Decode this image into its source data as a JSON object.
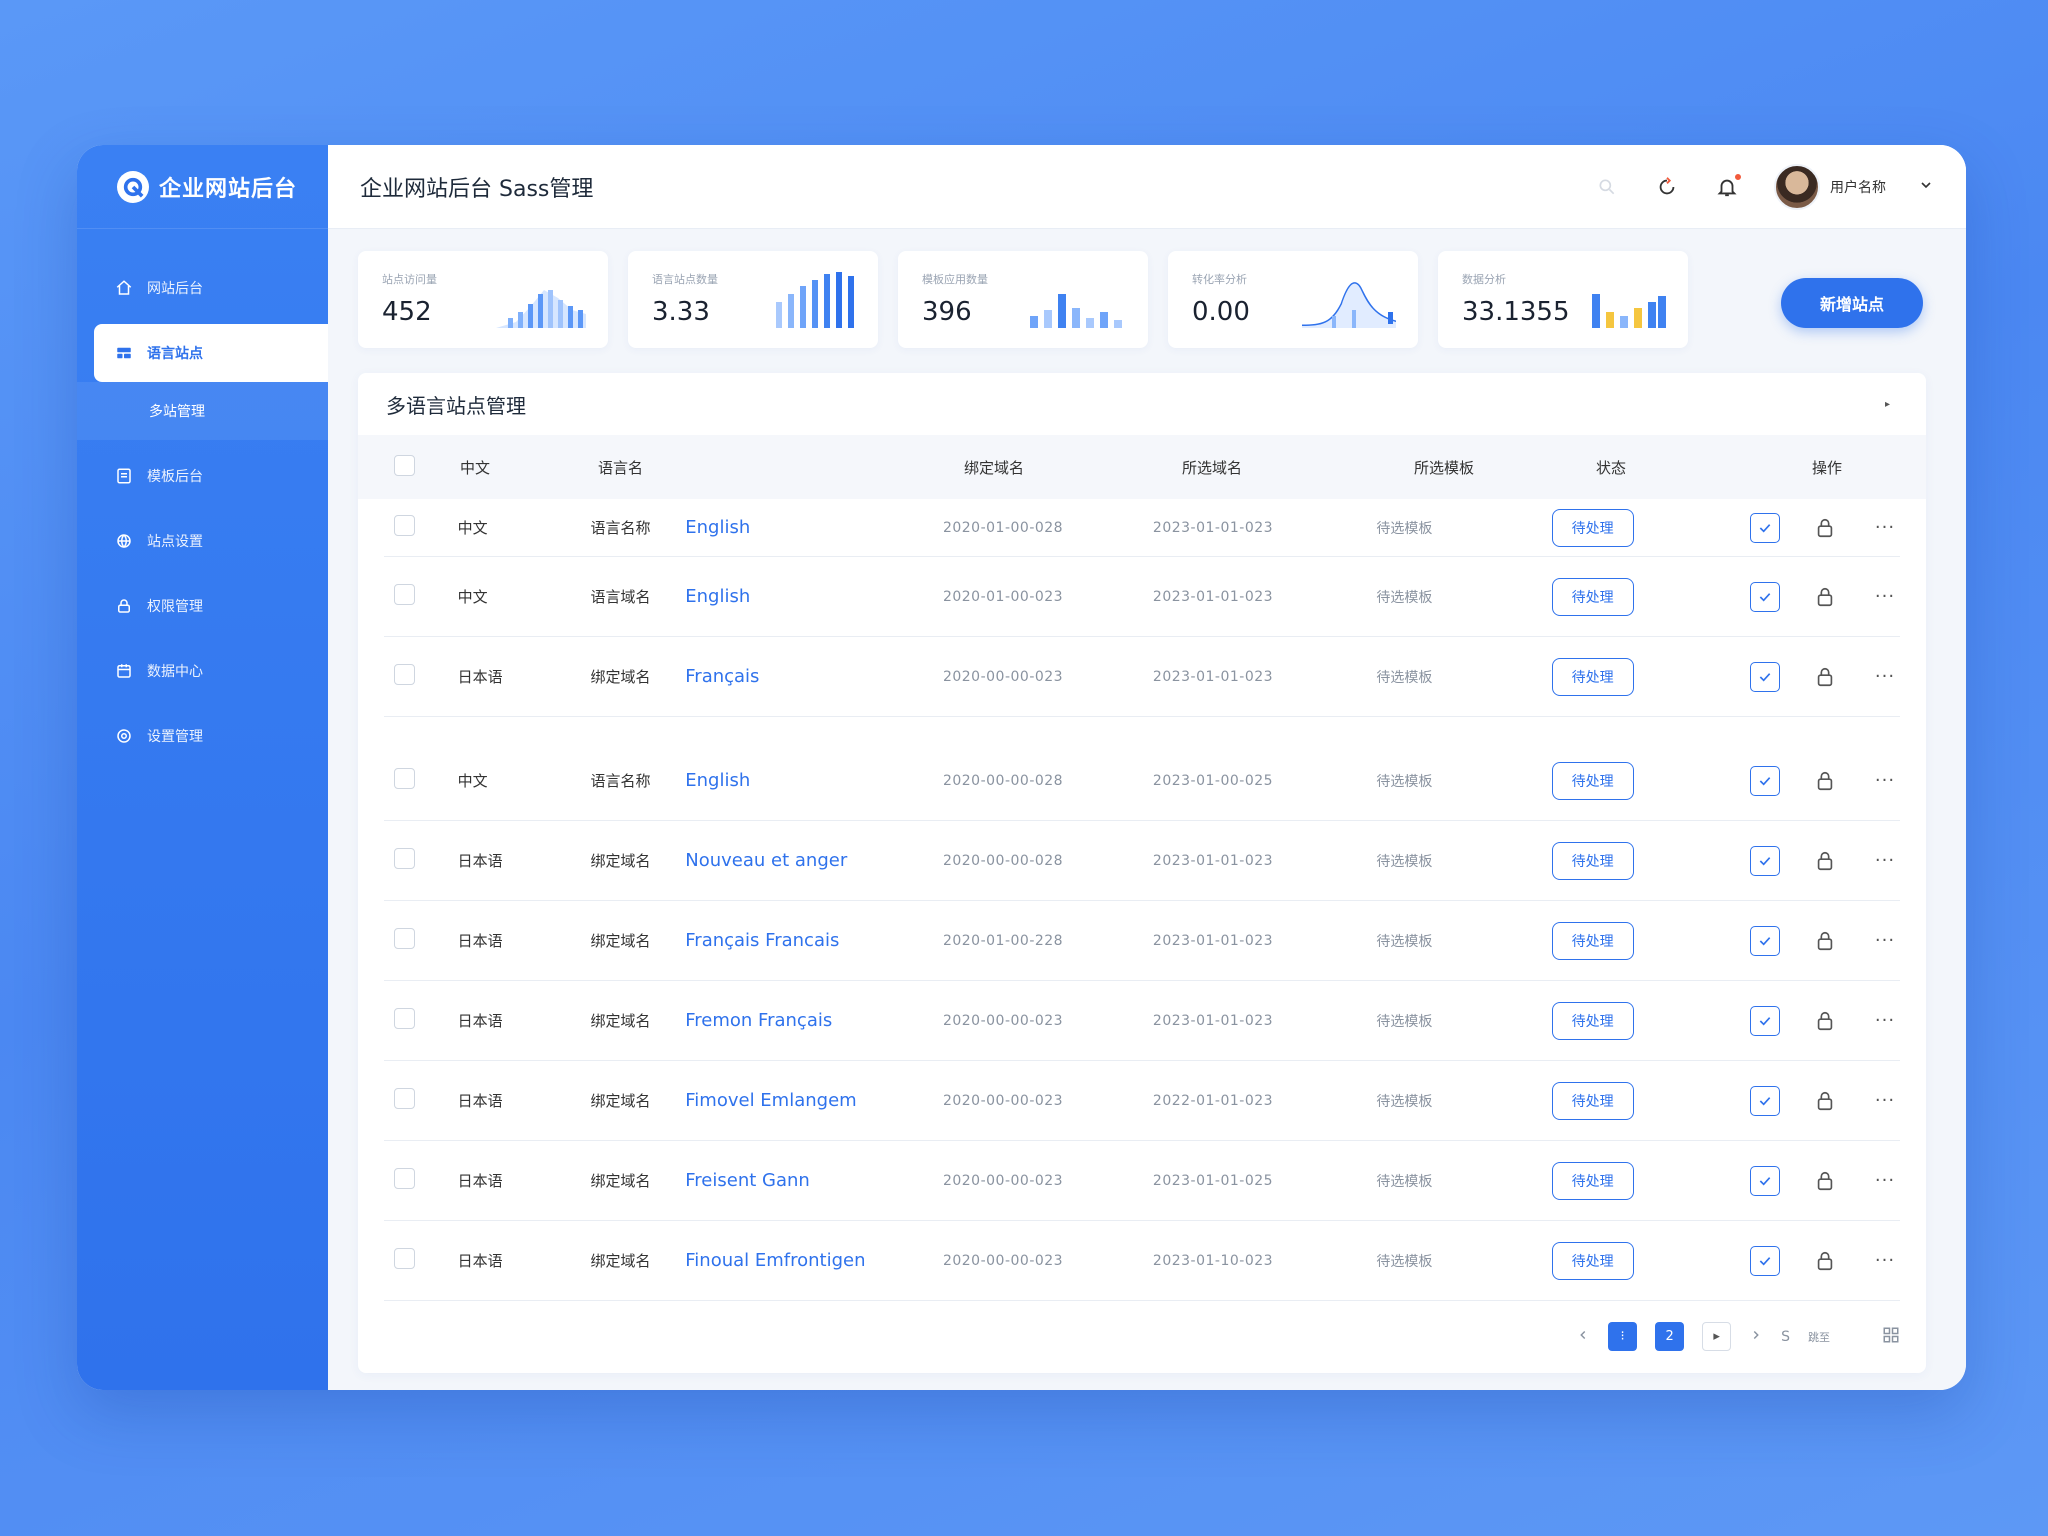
{
  "brand": {
    "title": "企业网站后台"
  },
  "sidebar": {
    "items": [
      {
        "label": "网站后台",
        "icon": "home-icon"
      },
      {
        "label": "语言站点",
        "icon": "layers-icon",
        "active": true
      },
      {
        "label": "多站管理",
        "icon": "",
        "sub": true
      },
      {
        "label": "模板后台",
        "icon": "document-icon"
      },
      {
        "label": "站点设置",
        "icon": "globe-icon"
      },
      {
        "label": "权限管理",
        "icon": "lock-icon"
      },
      {
        "label": "数据中心",
        "icon": "calendar-icon"
      },
      {
        "label": "设置管理",
        "icon": "settings-icon"
      }
    ]
  },
  "header": {
    "title": "企业网站后台 Sass管理",
    "user_name": "用户名称"
  },
  "stats": [
    {
      "label": "站点访问量",
      "value": "452",
      "chart": "area-bars"
    },
    {
      "label": "语言站点数量",
      "value": "3.33",
      "chart": "bars"
    },
    {
      "label": "模板应用数量",
      "value": "396",
      "chart": "small-bars"
    },
    {
      "label": "转化率分析",
      "value": "0.00",
      "chart": "bell"
    },
    {
      "label": "数据分析",
      "value": "33.1355",
      "chart": "color-bars"
    }
  ],
  "actions": {
    "new_site": "新增站点"
  },
  "panel": {
    "title": "多语言站点管理",
    "columns": [
      "中文",
      "语言名",
      "绑定域名",
      "所选域名",
      "所选模板",
      "状态",
      "操作"
    ],
    "rows": [
      {
        "cn": "中文",
        "key": "语言名称",
        "val": "English",
        "d1": "2020-01-00-028",
        "d2": "2023-01-01-023",
        "tpl": "待选模板",
        "status": "待处理"
      },
      {
        "cn": "中文",
        "key": "语言域名",
        "val": "English",
        "d1": "2020-01-00-023",
        "d2": "2023-01-01-023",
        "tpl": "待选模板",
        "status": "待处理"
      },
      {
        "cn": "日本语",
        "key": "绑定域名",
        "val": "Français",
        "d1": "2020-00-00-023",
        "d2": "2023-01-01-023",
        "tpl": "待选模板",
        "status": "待处理"
      },
      {
        "cn": "中文",
        "key": "语言名称",
        "val": "English",
        "d1": "2020-00-00-028",
        "d2": "2023-01-00-025",
        "tpl": "待选模板",
        "status": "待处理"
      },
      {
        "cn": "日本语",
        "key": "绑定域名",
        "val": "Nouveau et anger",
        "d1": "2020-00-00-028",
        "d2": "2023-01-01-023",
        "tpl": "待选模板",
        "status": "待处理"
      },
      {
        "cn": "日本语",
        "key": "绑定域名",
        "val": "Français Francais",
        "d1": "2020-01-00-228",
        "d2": "2023-01-01-023",
        "tpl": "待选模板",
        "status": "待处理"
      },
      {
        "cn": "日本语",
        "key": "绑定域名",
        "val": "Fremon Français",
        "d1": "2020-00-00-023",
        "d2": "2023-01-01-023",
        "tpl": "待选模板",
        "status": "待处理"
      },
      {
        "cn": "日本语",
        "key": "绑定域名",
        "val": "Fimovel Emlangem",
        "d1": "2020-00-00-023",
        "d2": "2022-01-01-023",
        "tpl": "待选模板",
        "status": "待处理"
      },
      {
        "cn": "日本语",
        "key": "绑定域名",
        "val": "Freisent Gann",
        "d1": "2020-00-00-023",
        "d2": "2023-01-01-025",
        "tpl": "待选模板",
        "status": "待处理"
      },
      {
        "cn": "日本语",
        "key": "绑定域名",
        "val": "Finoual Emfrontigen",
        "d1": "2020-00-00-023",
        "d2": "2023-01-10-023",
        "tpl": "待选模板",
        "status": "待处理"
      }
    ]
  },
  "pagination": {
    "pages": [
      "1",
      "2"
    ],
    "total": "S",
    "jump": "跳至"
  },
  "colors": {
    "primary": "#2f72ec",
    "bg": "#4b88f2"
  }
}
